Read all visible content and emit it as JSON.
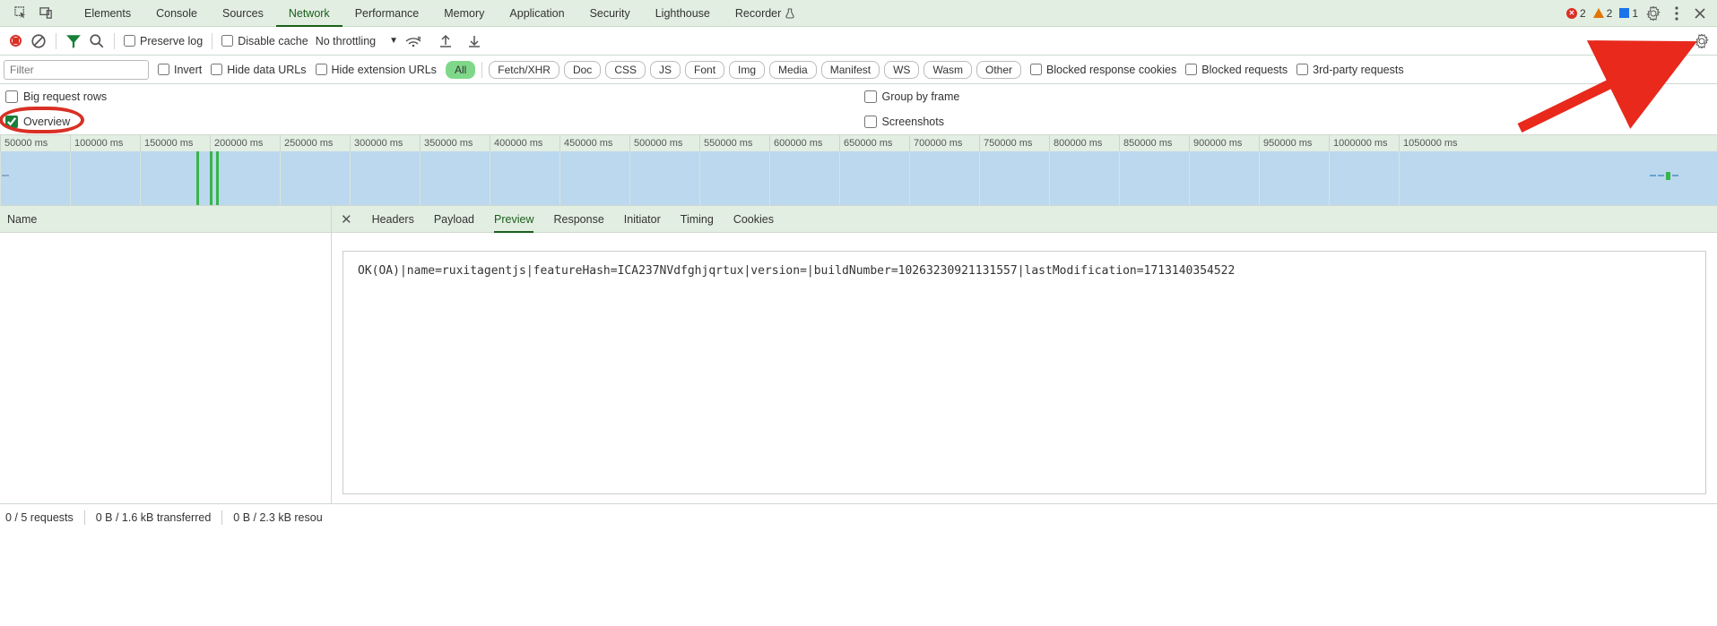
{
  "mainTabs": [
    "Elements",
    "Console",
    "Sources",
    "Network",
    "Performance",
    "Memory",
    "Application",
    "Security",
    "Lighthouse",
    "Recorder"
  ],
  "activeMainTab": "Network",
  "topRight": {
    "errors": "2",
    "warnings": "2",
    "issues": "1"
  },
  "toolbar": {
    "preserve_log": "Preserve log",
    "disable_cache": "Disable cache",
    "throttling": "No throttling"
  },
  "filter": {
    "placeholder": "Filter",
    "invert": "Invert",
    "hide_data": "Hide data URLs",
    "hide_ext": "Hide extension URLs",
    "blocked_cookies": "Blocked response cookies",
    "blocked_req": "Blocked requests",
    "third_party": "3rd-party requests"
  },
  "typePills": [
    "All",
    "Fetch/XHR",
    "Doc",
    "CSS",
    "JS",
    "Font",
    "Img",
    "Media",
    "Manifest",
    "WS",
    "Wasm",
    "Other"
  ],
  "activePill": "All",
  "options": {
    "big_rows": "Big request rows",
    "overview": "Overview",
    "group_frame": "Group by frame",
    "screenshots": "Screenshots"
  },
  "timeline_ticks": [
    "50000 ms",
    "100000 ms",
    "150000 ms",
    "200000 ms",
    "250000 ms",
    "300000 ms",
    "350000 ms",
    "400000 ms",
    "450000 ms",
    "500000 ms",
    "550000 ms",
    "600000 ms",
    "650000 ms",
    "700000 ms",
    "750000 ms",
    "800000 ms",
    "850000 ms",
    "900000 ms",
    "950000 ms",
    "1000000 ms",
    "1050000 ms"
  ],
  "reqHeader": "Name",
  "detailTabs": [
    "Headers",
    "Payload",
    "Preview",
    "Response",
    "Initiator",
    "Timing",
    "Cookies"
  ],
  "activeDetailTab": "Preview",
  "previewText": "OK(OA)|name=ruxitagentjs|featureHash=ICA237NVdfghjqrtux|version=|buildNumber=10263230921131557|lastModification=1713140354522",
  "status": {
    "requests": "0 / 5 requests",
    "transferred": "0 B / 1.6 kB transferred",
    "resources": "0 B / 2.3 kB resou"
  }
}
